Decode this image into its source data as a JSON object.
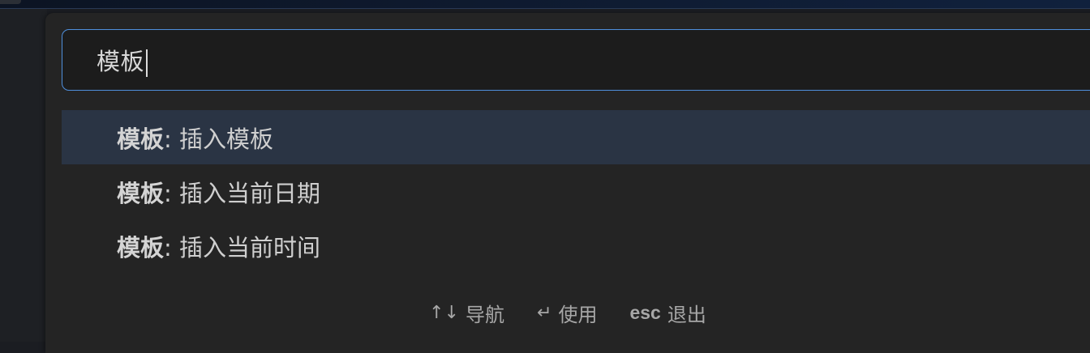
{
  "search": {
    "value": "模板"
  },
  "results": [
    {
      "prefix": "模板",
      "separator": ": ",
      "label": "插入模板"
    },
    {
      "prefix": "模板",
      "separator": ": ",
      "label": "插入当前日期"
    },
    {
      "prefix": "模板",
      "separator": ": ",
      "label": "插入当前时间"
    }
  ],
  "footer": {
    "navigate": {
      "keys": "↑↓",
      "label": "导航"
    },
    "use": {
      "keys": "↵",
      "label": "使用"
    },
    "dismiss": {
      "keys": "esc",
      "label": "退出"
    }
  }
}
